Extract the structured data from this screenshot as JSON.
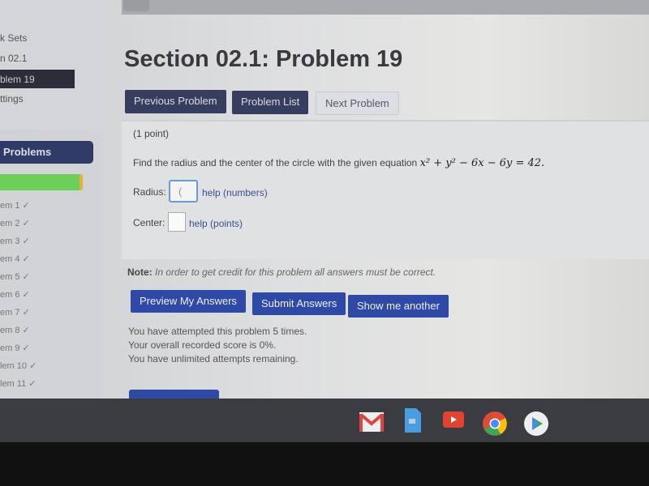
{
  "sidebar": {
    "links": [
      "k Sets",
      "n 02.1",
      "blem 19",
      "ttings"
    ],
    "problems_header": "Problems",
    "progress_percent": 95,
    "problems": [
      "em 1 ✓",
      "em 2 ✓",
      "em 3 ✓",
      "em 4 ✓",
      "em 5 ✓",
      "em 6 ✓",
      "em 7 ✓",
      "em 8 ✓",
      "em 9 ✓",
      "lem 10 ✓",
      "lem 11 ✓"
    ]
  },
  "page_title": "Section 02.1: Problem 19",
  "nav": {
    "previous": "Previous Problem",
    "list": "Problem List",
    "next": "Next Problem"
  },
  "problem": {
    "points": "(1 point)",
    "statement": "Find the radius and the center of the circle with the given equation",
    "equation": "x² + y² − 6x − 6y = 42.",
    "radius_label": "Radius:",
    "radius_value": "(",
    "radius_help": "help (numbers)",
    "center_label": "Center:",
    "center_value": "",
    "center_help": "help (points)"
  },
  "note": {
    "label": "Note:",
    "text": "In order to get credit for this problem all answers must be correct."
  },
  "actions": {
    "preview": "Preview My Answers",
    "submit": "Submit Answers",
    "another": "Show me another"
  },
  "status": [
    "You have attempted this problem 5 times.",
    "Your overall recorded score is 0%.",
    "You have unlimited attempts remaining."
  ],
  "shelf": {
    "apps": [
      "gmail-icon",
      "docs-icon",
      "youtube-icon",
      "chrome-icon",
      "play-store-icon"
    ]
  }
}
